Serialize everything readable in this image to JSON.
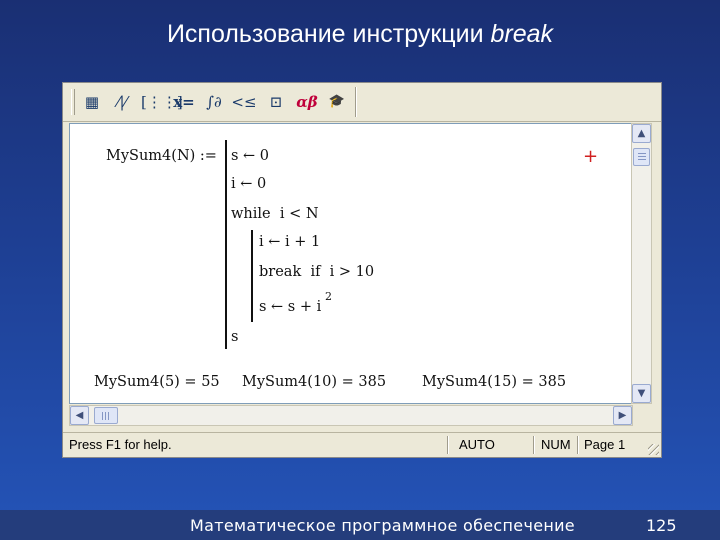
{
  "slide": {
    "title_prefix": "Использование инструкции",
    "title_keyword": "break",
    "footer": "Математическое программное обеспечение",
    "page_number": "125"
  },
  "toolbar": {
    "buttons": [
      {
        "name": "calculator-icon",
        "glyph": "▦"
      },
      {
        "name": "graph-icon",
        "glyph": "⁄|⁄"
      },
      {
        "name": "matrix-icon",
        "glyph": "[⋮⋮]"
      },
      {
        "name": "evaluation-icon",
        "glyph": "x="
      },
      {
        "name": "calculus-icon",
        "glyph": "∫∂"
      },
      {
        "name": "boolean-icon",
        "glyph": "<≤"
      },
      {
        "name": "programming-icon",
        "glyph": "⊡"
      },
      {
        "name": "greek-icon",
        "glyph": "αβ"
      },
      {
        "name": "symbolic-icon",
        "glyph": "🎓"
      }
    ]
  },
  "worksheet": {
    "definition_name": "MySum4(N) :=",
    "program_lines": {
      "line1": "s ← 0",
      "line2": "i ← 0",
      "line3": "while  i < N",
      "line4": "i ← i + 1",
      "line5": "break  if  i > 10",
      "line6": "s ← s + i",
      "line6_exp": "2",
      "line7": "s"
    },
    "results": [
      "MySum4(5) = 55",
      "MySum4(10) = 385",
      "MySum4(15) = 385"
    ],
    "crosshair": "+"
  },
  "scrollbars": {
    "up": "▲",
    "down": "▼",
    "left": "◀",
    "right": "▶"
  },
  "statusbar": {
    "help": "Press F1 for help.",
    "mode": "AUTO",
    "num": "NUM",
    "page": "Page 1"
  },
  "colors": {
    "background": "#1e3f93",
    "toolbar": "#ece9d8",
    "worksheet": "#ffffff",
    "cursor_cross": "#d02020"
  }
}
